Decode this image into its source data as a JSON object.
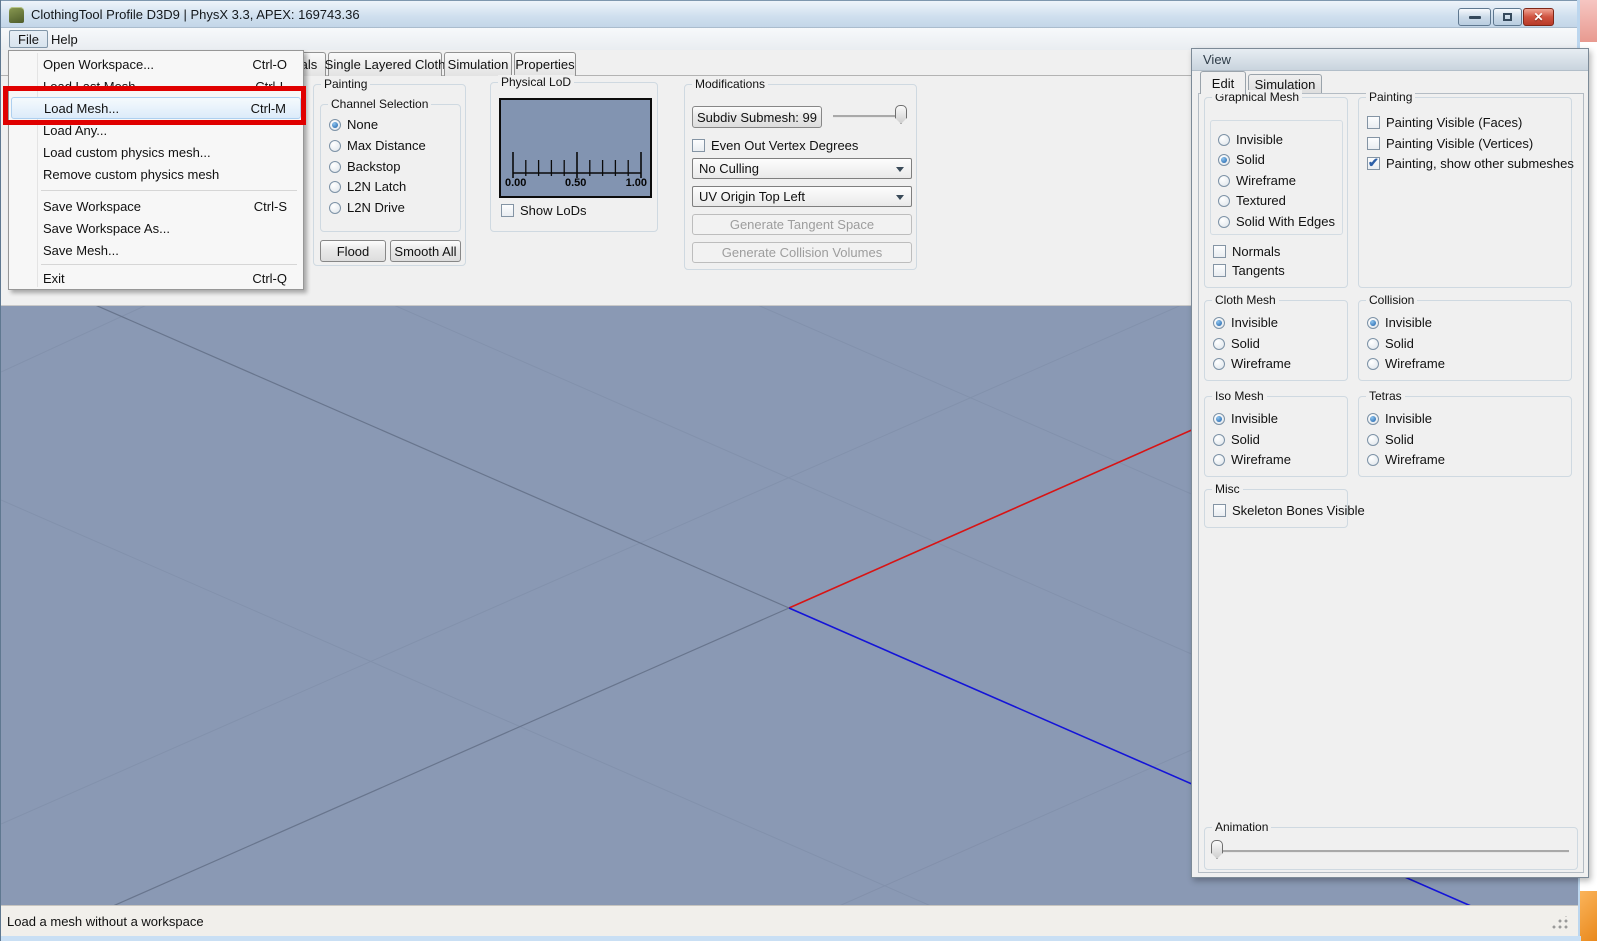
{
  "title_bar": {
    "title": "ClothingTool Profile D3D9 | PhysX 3.3, APEX: 169743.36"
  },
  "menu_bar": {
    "file": "File",
    "help": "Help"
  },
  "file_menu": {
    "highlighted_item": "Load Mesh...",
    "items": [
      {
        "label": "Open Workspace...",
        "shortcut": "Ctrl-O"
      },
      {
        "label": "Load Last Mesh",
        "shortcut": "Ctrl-L"
      },
      {
        "label": "Load Mesh...",
        "shortcut": "Ctrl-M"
      },
      {
        "label": "Load Any...",
        "shortcut": ""
      },
      {
        "label": "Load custom physics mesh...",
        "shortcut": ""
      },
      {
        "label": "Remove custom physics mesh",
        "shortcut": ""
      },
      {
        "label": "Save Workspace",
        "shortcut": "Ctrl-S"
      },
      {
        "label": "Save Workspace As...",
        "shortcut": ""
      },
      {
        "label": "Save Mesh...",
        "shortcut": ""
      },
      {
        "label": "Exit",
        "shortcut": "Ctrl-Q"
      }
    ]
  },
  "toolbar_tabs": {
    "materials_partial": "ials",
    "single_layered_cloth": "Single Layered Cloth",
    "simulation": "Simulation",
    "properties": "Properties"
  },
  "painting_panel": {
    "title": "Painting",
    "channel_selection": {
      "title": "Channel Selection",
      "options": [
        "None",
        "Max Distance",
        "Backstop",
        "L2N Latch",
        "L2N Drive"
      ],
      "selected": "None"
    },
    "flood": "Flood",
    "smooth_all": "Smooth All"
  },
  "physical_lod": {
    "title": "Physical LoD",
    "ticks": [
      "0.00",
      "0.50",
      "1.00"
    ],
    "show_lods": "Show LoDs",
    "show_lods_checked": false
  },
  "modifications": {
    "title": "Modifications",
    "subdiv_button": "Subdiv Submesh: 99",
    "even_out": "Even Out Vertex Degrees",
    "even_out_checked": false,
    "culling_select": "No Culling",
    "uv_origin_select": "UV Origin Top Left",
    "generate_tangent": "Generate Tangent Space",
    "generate_collision": "Generate Collision Volumes"
  },
  "view_panel": {
    "title": "View",
    "tabs": {
      "edit": "Edit",
      "simulation": "Simulation",
      "active": "Edit"
    },
    "graphical_mesh": {
      "title": "Graphical Mesh",
      "options": [
        "Invisible",
        "Solid",
        "Wireframe",
        "Textured",
        "Solid With Edges"
      ],
      "selected": "Solid",
      "normals": "Normals",
      "normals_checked": false,
      "tangents": "Tangents",
      "tangents_checked": false
    },
    "painting": {
      "title": "Painting",
      "items": [
        {
          "label": "Painting Visible (Faces)",
          "checked": false
        },
        {
          "label": "Painting Visible (Vertices)",
          "checked": false
        },
        {
          "label": "Painting, show other submeshes",
          "checked": true
        }
      ]
    },
    "cloth_mesh": {
      "title": "Cloth Mesh",
      "options": [
        "Invisible",
        "Solid",
        "Wireframe"
      ],
      "selected": "Invisible"
    },
    "collision": {
      "title": "Collision",
      "options": [
        "Invisible",
        "Solid",
        "Wireframe"
      ],
      "selected": "Invisible"
    },
    "iso_mesh": {
      "title": "Iso Mesh",
      "options": [
        "Invisible",
        "Solid",
        "Wireframe"
      ],
      "selected": "Invisible"
    },
    "tetras": {
      "title": "Tetras",
      "options": [
        "Invisible",
        "Solid",
        "Wireframe"
      ],
      "selected": "Invisible"
    },
    "misc": {
      "title": "Misc",
      "skeleton": "Skeleton Bones Visible",
      "skeleton_checked": false
    },
    "animation": {
      "title": "Animation",
      "value": 0
    }
  },
  "status_bar": {
    "text": "Load a mesh without a workspace"
  },
  "annotation": {
    "shape": "rectangle",
    "color": "#e00000",
    "marks": "Load Mesh..."
  },
  "colors": {
    "viewport_bg": "#8a99b4",
    "axis_red": "#d81414",
    "axis_blue": "#1414d8",
    "lod_panel_bg": "#8294b1",
    "annotation": "#e00000"
  }
}
